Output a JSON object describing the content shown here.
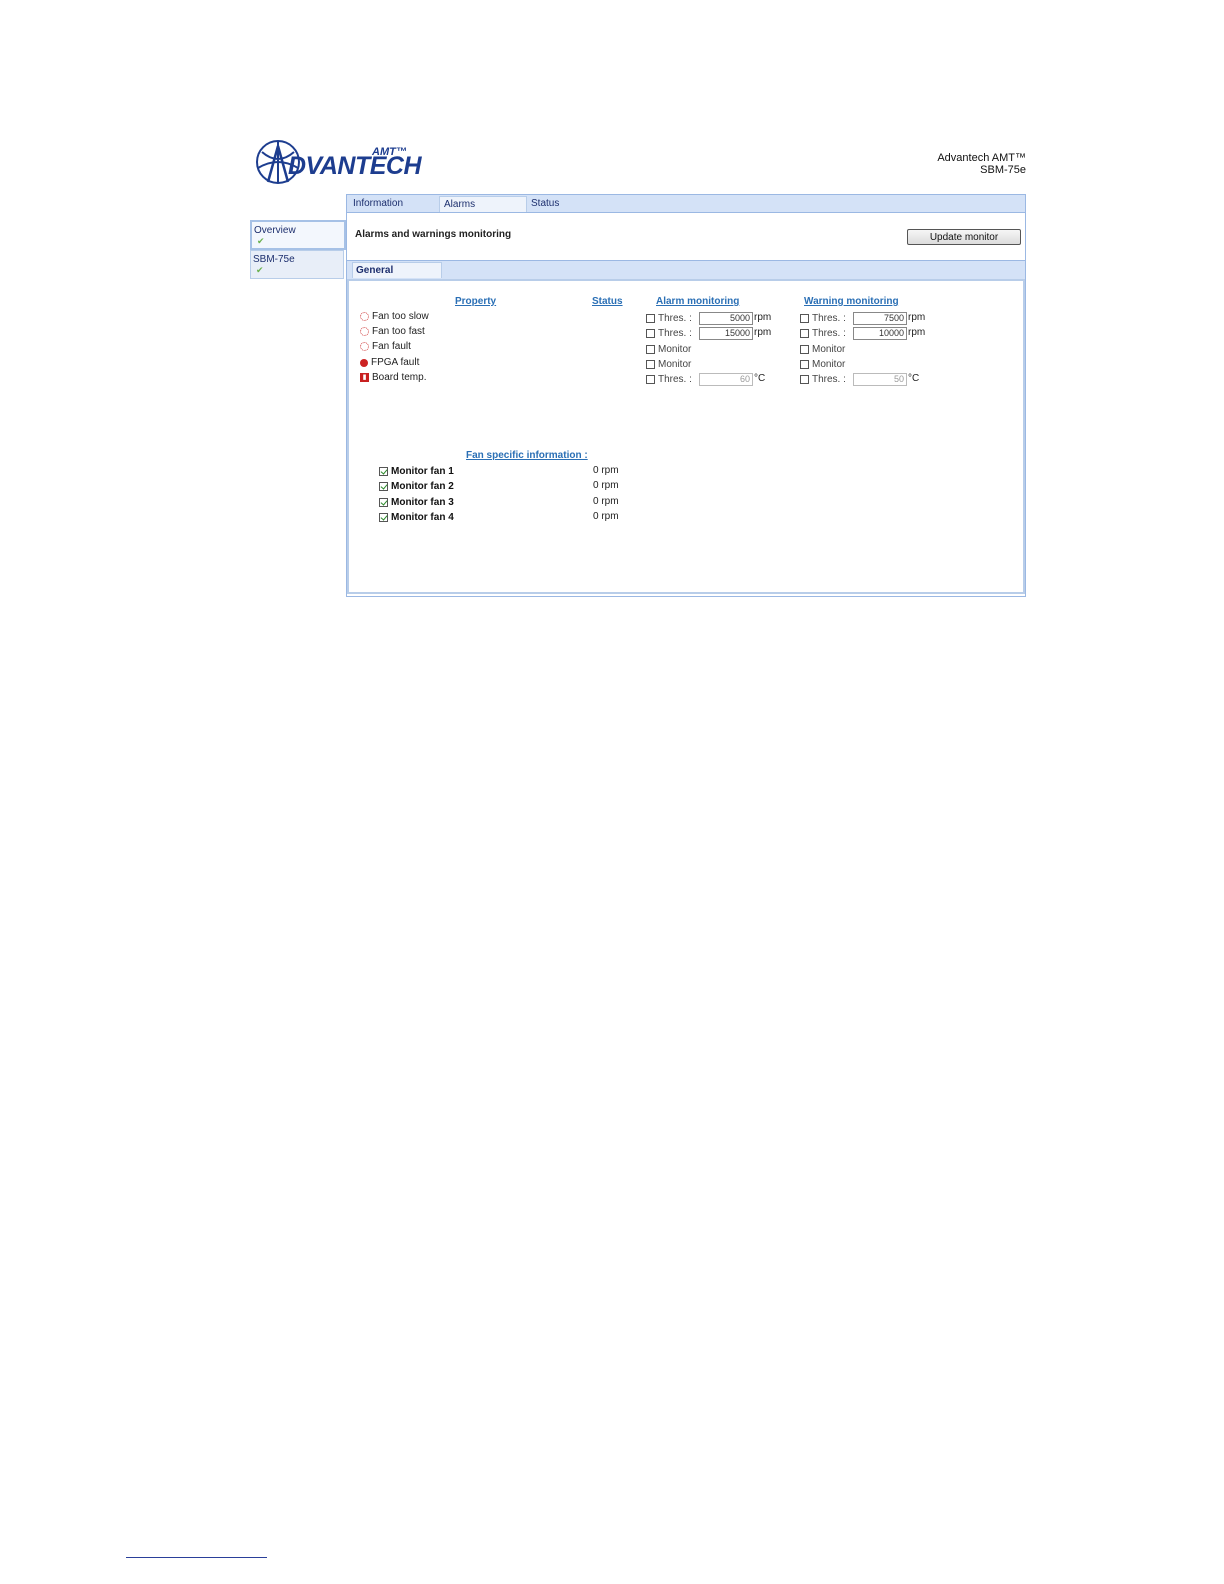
{
  "header": {
    "logo_text": "DVANTECH",
    "logo_superscript": "AMT™",
    "brand_line1": "Advantech AMT™",
    "brand_line2": "SBM-75e"
  },
  "sidebar": {
    "items": [
      {
        "label": "Overview",
        "status_icon": "checkmark-icon"
      },
      {
        "label": "SBM-75e",
        "status_icon": "checkmark-icon"
      }
    ]
  },
  "tabs": [
    {
      "label": "Information"
    },
    {
      "label": "Alarms"
    },
    {
      "label": "Status"
    }
  ],
  "main": {
    "title": "Alarms and warnings monitoring",
    "update_button": "Update monitor",
    "subtab": "General",
    "columns": {
      "property": "Property",
      "status": "Status",
      "alarm": "Alarm monitoring",
      "warning": "Warning monitoring"
    },
    "properties": [
      {
        "label": "Fan too slow",
        "icon": "fan-icon"
      },
      {
        "label": "Fan too fast",
        "icon": "fan-icon"
      },
      {
        "label": "Fan fault",
        "icon": "fan-icon"
      },
      {
        "label": "FPGA fault",
        "icon": "gear-icon"
      },
      {
        "label": "Board temp.",
        "icon": "thermometer-icon"
      }
    ],
    "alarm": {
      "thres_label": "Thres. :",
      "monitor_label": "Monitor",
      "slow_value": "5000",
      "fast_value": "15000",
      "temp_value": "60",
      "unit_rpm": "rpm",
      "unit_temp": "°C"
    },
    "warning": {
      "thres_label": "Thres. :",
      "monitor_label": "Monitor",
      "slow_value": "7500",
      "fast_value": "10000",
      "temp_value": "50",
      "unit_rpm": "rpm",
      "unit_temp": "°C"
    },
    "fan_info_title": "Fan specific information :",
    "fans": [
      {
        "label": "Monitor fan 1",
        "value": "0 rpm",
        "checked": true
      },
      {
        "label": "Monitor fan 2",
        "value": "0 rpm",
        "checked": true
      },
      {
        "label": "Monitor fan 3",
        "value": "0 rpm",
        "checked": true
      },
      {
        "label": "Monitor fan 4",
        "value": "0 rpm",
        "checked": true
      }
    ]
  }
}
